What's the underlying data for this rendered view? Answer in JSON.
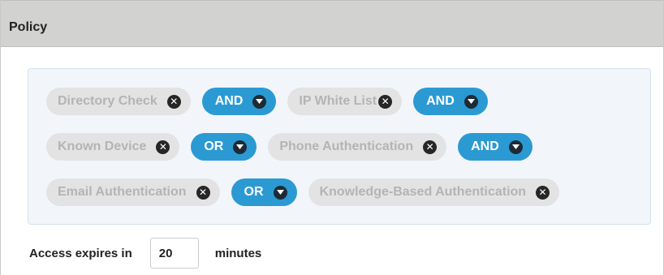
{
  "panel": {
    "title": "Policy"
  },
  "rules": {
    "rows": [
      {
        "items": [
          {
            "kind": "factor",
            "label": "Directory Check"
          },
          {
            "kind": "operator",
            "label": "AND"
          },
          {
            "kind": "factor",
            "label": "IP White List"
          },
          {
            "kind": "operator",
            "label": "AND"
          }
        ]
      },
      {
        "items": [
          {
            "kind": "factor",
            "label": "Known Device"
          },
          {
            "kind": "operator",
            "label": "OR"
          },
          {
            "kind": "factor",
            "label": "Phone Authentication"
          },
          {
            "kind": "operator",
            "label": "AND"
          }
        ]
      },
      {
        "items": [
          {
            "kind": "factor",
            "label": "Email Authentication"
          },
          {
            "kind": "operator",
            "label": "OR"
          },
          {
            "kind": "factor",
            "label": "Knowledge-Based Authentication"
          }
        ]
      }
    ]
  },
  "expiry": {
    "label": "Access expires in",
    "value": "20",
    "unit": "minutes"
  },
  "icons": {
    "remove": "close-circle-icon",
    "dropdown": "caret-down-circle-icon"
  },
  "colors": {
    "header_bg": "#d2d2d0",
    "rules_bg": "#f2f6fa",
    "factor_bg": "#e3e3e3",
    "factor_text": "#b4b4b4",
    "operator_bg": "#2b9ad3",
    "operator_text": "#ffffff"
  }
}
